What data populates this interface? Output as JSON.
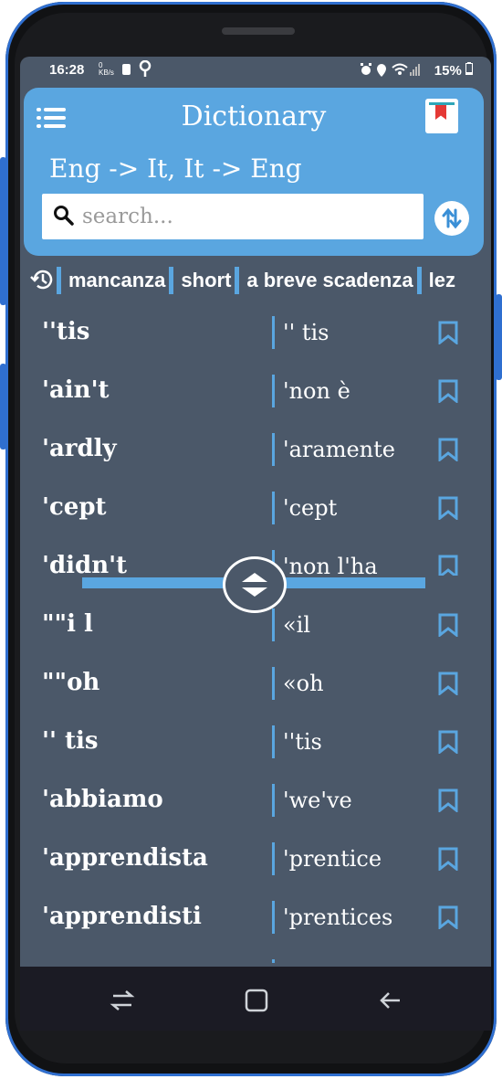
{
  "status_bar": {
    "time": "16:28",
    "net_speed": "0 KB/s",
    "battery": "15%"
  },
  "header": {
    "title": "Dictionary",
    "subtitle": "Eng -> It,  It -> Eng"
  },
  "search": {
    "placeholder": "search..."
  },
  "history": [
    "mancanza",
    "short",
    "a breve scadenza",
    "lez"
  ],
  "words": [
    {
      "word": "''tis",
      "translation": "'' tis"
    },
    {
      "word": "'ain't",
      "translation": "'non è"
    },
    {
      "word": "'ardly",
      "translation": "'aramente"
    },
    {
      "word": "'cept",
      "translation": "'cept"
    },
    {
      "word": "'didn't",
      "translation": "'non l'ha"
    },
    {
      "word": "\"\"i l",
      "translation": "«il"
    },
    {
      "word": "\"\"oh",
      "translation": "«oh"
    },
    {
      "word": "'' tis",
      "translation": "''tis"
    },
    {
      "word": "'abbiamo",
      "translation": "'we've"
    },
    {
      "word": "'apprendista",
      "translation": "'prentice"
    },
    {
      "word": "'apprendisti",
      "translation": "'prentices"
    }
  ],
  "colors": {
    "accent": "#5aa6e0",
    "background": "#4b5869",
    "bookmark_ribbon": "#e53935"
  },
  "icons": {
    "menu": "menu-icon",
    "bookmarks": "bookmark-book-icon",
    "search": "search-icon",
    "swap": "swap-languages-icon",
    "history": "history-icon",
    "divider_handle": "resize-handle-icon",
    "nav_recents": "recents-icon",
    "nav_home": "home-icon",
    "nav_back": "back-icon"
  }
}
